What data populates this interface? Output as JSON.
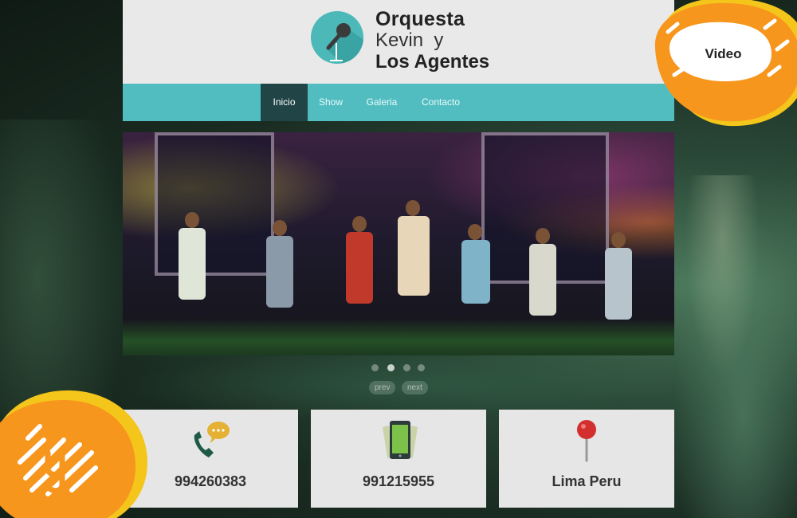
{
  "brand": {
    "line1": "Orquesta",
    "line2": "Kevin  y",
    "line3": "Los Agentes"
  },
  "nav": {
    "items": [
      {
        "label": "Inicio",
        "active": true
      },
      {
        "label": "Show",
        "active": false
      },
      {
        "label": "Galeria",
        "active": false
      },
      {
        "label": "Contacto",
        "active": false
      }
    ]
  },
  "slider": {
    "dots_count": 4,
    "active_dot": 2,
    "prev_label": "prev",
    "next_label": "next"
  },
  "contacts": [
    {
      "icon": "phone-chat-icon",
      "value": "994260383"
    },
    {
      "icon": "mobile-phone-icon",
      "value": "991215955"
    },
    {
      "icon": "map-pin-icon",
      "value": "Lima Peru"
    }
  ],
  "badges": {
    "video_label": "Video"
  },
  "colors": {
    "nav_bg": "#52bdc0",
    "nav_active": "#214446",
    "header_bg": "#e9e9e9",
    "logo_circle": "#4cb8b8",
    "badge_orange": "#f7961d",
    "badge_yellow": "#f4c51a"
  }
}
